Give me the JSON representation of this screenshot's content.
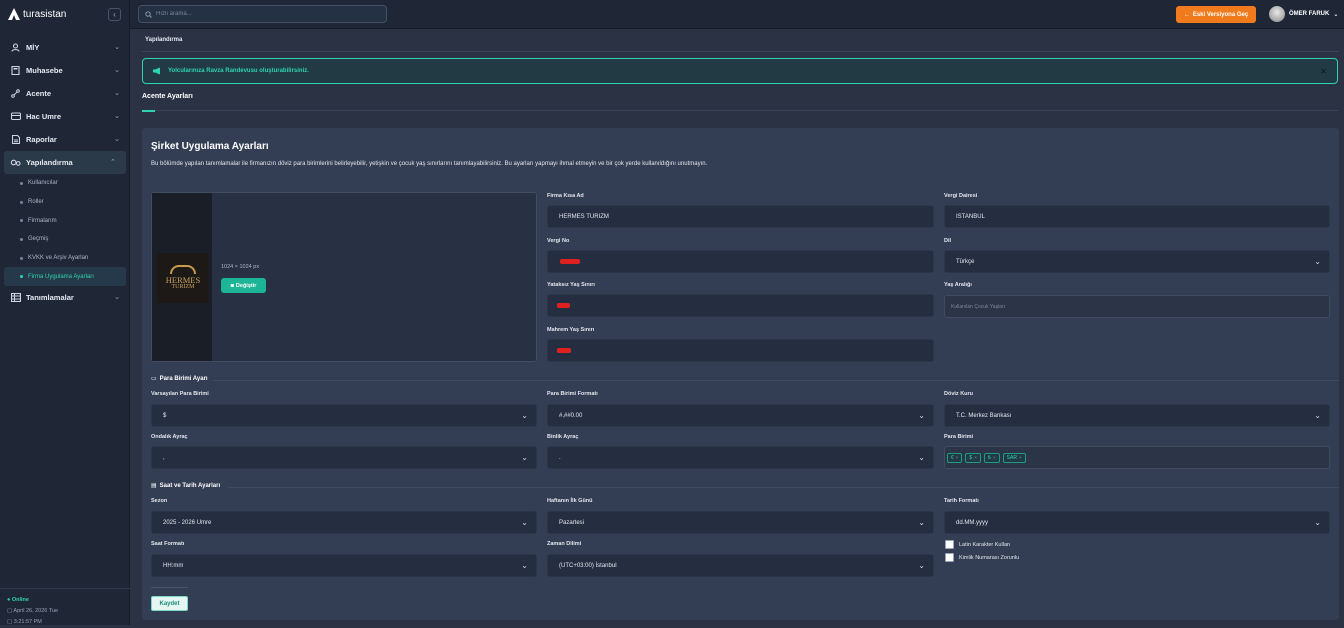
{
  "app": {
    "logo_text": "turasistan"
  },
  "sidebar": {
    "items": [
      {
        "label": "MİY",
        "icon": "user-icon"
      },
      {
        "label": "Muhasebe",
        "icon": "calculator-icon"
      },
      {
        "label": "Acente",
        "icon": "agency-icon"
      },
      {
        "label": "Hac Umre",
        "icon": "bus-icon"
      },
      {
        "label": "Raporlar",
        "icon": "report-icon"
      },
      {
        "label": "Yapılandırma",
        "icon": "gear-icon"
      }
    ],
    "sub_items": [
      "Kullanıcılar",
      "Roller",
      "Firmalarım",
      "Geçmiş",
      "KVKK ve Arşiv Ayarları",
      "Firma Uygulama Ayarları"
    ],
    "last_item": {
      "label": "Tanımlamalar",
      "icon": "grid-icon"
    },
    "status": {
      "online": "Online",
      "date": "April 26, 2026 Tue",
      "time": "3:21:57 PM"
    }
  },
  "topbar": {
    "search_placeholder": "Hızlı arama...",
    "old_version_label": "Eski Versiyona Geç",
    "user_name": "ÖMER FARUK"
  },
  "breadcrumb": "Yapılandırma",
  "alert": {
    "text": "Yolcularınıza Ravza Randevusu oluşturabilirsiniz."
  },
  "tab": "Acente Ayarları",
  "card": {
    "title": "Şirket Uygulama Ayarları",
    "description": "Bu bölümde yapılan tanımlamalar ile firmanızın döviz para birimlerini belirleyebilir, yetişkin ve çocuk yaş sınırlarını tanımlayabilirsiniz. Bu ayarları yapmayı ihmal etmeyin ve bir çok yerde kullanıldığını unutmayın."
  },
  "image": {
    "size_text": "1024 × 1024 px",
    "change_label": "Değiştir",
    "logo_line1": "HERMES",
    "logo_line2": "TURİZM"
  },
  "company": {
    "short_name_label": "Firma Kısa Ad",
    "short_name": "HERMES TURIZM",
    "tax_office_label": "Vergi Dairesi",
    "tax_office": "ISTANBUL",
    "tax_no_label": "Vergi No",
    "language_label": "Dil",
    "language": "Türkçe",
    "bed_age_label": "Yataksız Yaş Sınırı",
    "age_range_label": "Yaş Aralığı",
    "age_range_placeholder": "Kullanılan Çocuk Yaşları",
    "mahram_age_label": "Mahrem Yaş Sınırı"
  },
  "currency": {
    "section_title": "Para Birimi Ayarı",
    "default_label": "Varsayılan Para Birimi",
    "default_value": "$",
    "format_label": "Para Birimi Formatı",
    "format_value": "#,##0.00",
    "rate_label": "Döviz Kuru",
    "rate_value": "T.C. Merkez Bankası",
    "decimal_label": "Ondalık Ayraç",
    "decimal_value": ",",
    "thousand_label": "Binlik Ayraç",
    "thousand_value": ".",
    "currencies_label": "Para Birimi",
    "currencies": [
      "€",
      "$",
      "₺",
      "SAR"
    ]
  },
  "datetime": {
    "section_title": "Saat ve Tarih Ayarları",
    "season_label": "Sezon",
    "season_value": "2025 - 2026 Umre",
    "week_start_label": "Haftanın İlk Günü",
    "week_start_value": "Pazartesi",
    "date_format_label": "Tarih Formatı",
    "date_format_value": "dd.MM.yyyy",
    "time_format_label": "Saat Formatı",
    "time_format_value": "HH:mm",
    "timezone_label": "Zaman Dilimi",
    "timezone_value": "(UTC+03:00) İstanbul",
    "latin_label": "Latin Karakter Kullan",
    "id_required_label": "Kimlik Numarası Zorunlu"
  },
  "save_label": "Kaydet"
}
